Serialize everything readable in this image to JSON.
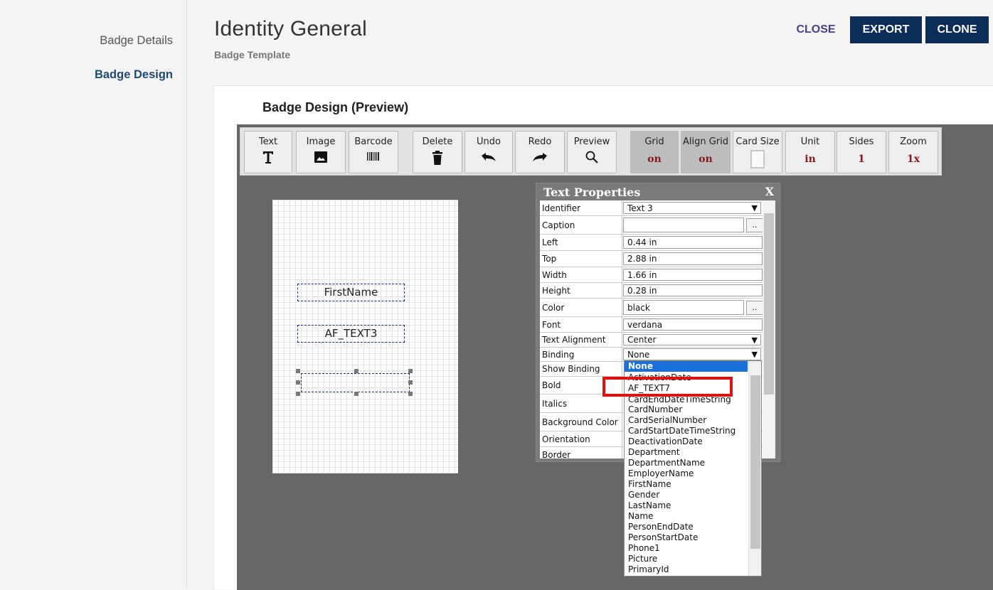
{
  "nav": {
    "items": [
      {
        "label": "Badge Details"
      },
      {
        "label": "Badge Design"
      }
    ]
  },
  "header": {
    "title": "Identity General",
    "subtitle": "Badge Template",
    "close_label": "CLOSE",
    "export_label": "EXPORT",
    "clone_label": "CLONE"
  },
  "card": {
    "title": "Badge Design (Preview)"
  },
  "toolbar": {
    "text": "Text",
    "image": "Image",
    "barcode": "Barcode",
    "delete": "Delete",
    "undo": "Undo",
    "redo": "Redo",
    "preview": "Preview",
    "grid": {
      "label": "Grid",
      "value": "on"
    },
    "align_grid": {
      "label": "Align Grid",
      "value": "on"
    },
    "card_size": "Card Size",
    "unit": {
      "label": "Unit",
      "value": "in"
    },
    "sides": {
      "label": "Sides",
      "value": "1"
    },
    "zoom": {
      "label": "Zoom",
      "value": "1x"
    }
  },
  "badge": {
    "fields": [
      "FirstName",
      "AF_TEXT3",
      ""
    ]
  },
  "panel": {
    "title": "Text Properties",
    "close": "X",
    "props": {
      "identifier": {
        "name": "Identifier",
        "value": "Text 3"
      },
      "caption": {
        "name": "Caption",
        "value": ""
      },
      "left": {
        "name": "Left",
        "value": "0.44 in"
      },
      "top": {
        "name": "Top",
        "value": "2.88 in"
      },
      "width": {
        "name": "Width",
        "value": "1.66 in"
      },
      "height": {
        "name": "Height",
        "value": "0.28 in"
      },
      "color": {
        "name": "Color",
        "value": "black"
      },
      "font": {
        "name": "Font",
        "value": "verdana"
      },
      "text_alignment": {
        "name": "Text Alignment",
        "value": "Center"
      },
      "binding": {
        "name": "Binding",
        "value": "None"
      },
      "show_binding": {
        "name": "Show Binding"
      },
      "bold": {
        "name": "Bold"
      },
      "italics": {
        "name": "Italics"
      },
      "background_color": {
        "name": "Background Color"
      },
      "orientation": {
        "name": "Orientation"
      },
      "border": {
        "name": "Border"
      }
    },
    "dots": ".."
  },
  "binding_dropdown": {
    "options": [
      "None",
      "ActivationDate",
      "AF_TEXT7",
      "CardEndDateTimeString",
      "CardNumber",
      "CardSerialNumber",
      "CardStartDateTimeString",
      "DeactivationDate",
      "Department",
      "DepartmentName",
      "EmployerName",
      "FirstName",
      "Gender",
      "LastName",
      "Name",
      "PersonEndDate",
      "PersonStartDate",
      "Phone1",
      "Picture",
      "PrimaryId"
    ],
    "selected": "None",
    "highlighted": "AF_TEXT7"
  },
  "colors": {
    "accent": "#0c2d57",
    "nav_active": "#1f4a78",
    "highlight": "#e01010",
    "toolbar_value": "#8b1a1a"
  }
}
